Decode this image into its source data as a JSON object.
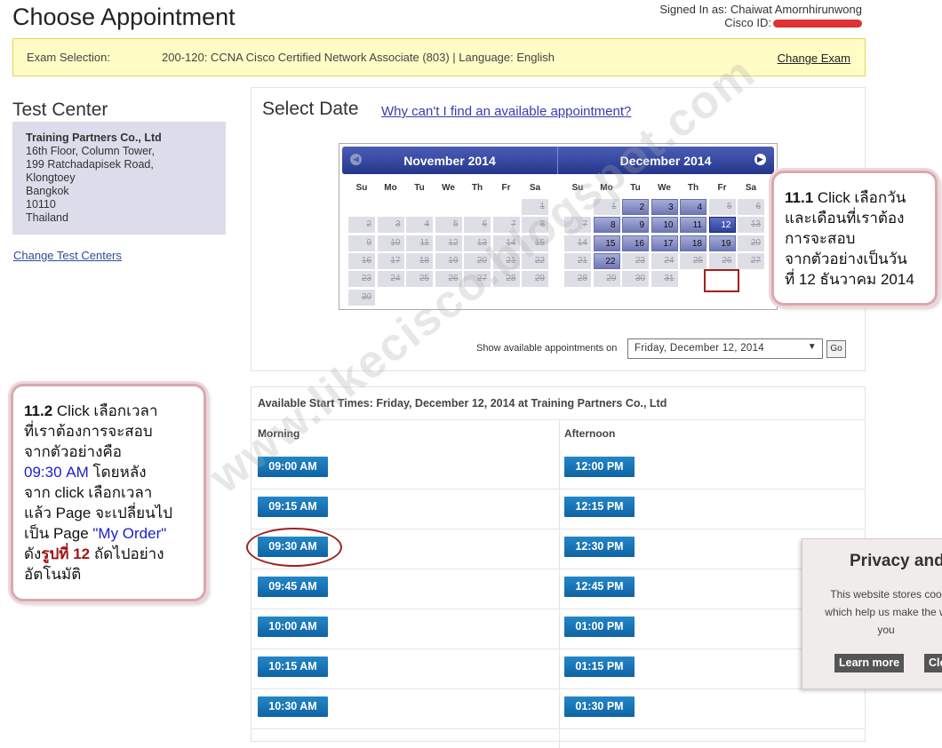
{
  "header": {
    "title": "Choose Appointment",
    "signed_in": "Signed In as: Chaiwat Amornhirunwong",
    "cisco_id_label": "Cisco ID:"
  },
  "exam": {
    "label": "Exam Selection:",
    "value": "200-120: CCNA Cisco Certified Network Associate (803) | Language: English",
    "change_label": "Change Exam"
  },
  "test_center": {
    "title": "Test Center",
    "name": "Training Partners Co., Ltd",
    "address_lines": [
      "16th Floor, Column Tower,",
      "199 Ratchadapisek Road,",
      "Klongtoey",
      "Bangkok",
      "10110",
      "Thailand"
    ],
    "change_label": "Change Test Centers"
  },
  "select_date": {
    "title": "Select Date",
    "help_link": "Why can't I find an available appointment?",
    "calendar": {
      "weekdays": [
        "Su",
        "Mo",
        "Tu",
        "We",
        "Th",
        "Fr",
        "Sa"
      ],
      "months": [
        {
          "name": "November 2014",
          "weeks": [
            [
              null,
              null,
              null,
              null,
              null,
              null,
              "1"
            ],
            [
              "2",
              "3",
              "4",
              "5",
              "6",
              "7",
              "8"
            ],
            [
              "9",
              "10",
              "11",
              "12",
              "13",
              "14",
              "15"
            ],
            [
              "16",
              "17",
              "18",
              "19",
              "20",
              "21",
              "22"
            ],
            [
              "23",
              "24",
              "25",
              "26",
              "27",
              "28",
              "29"
            ],
            [
              "30",
              null,
              null,
              null,
              null,
              null,
              null
            ]
          ],
          "available": [],
          "selected": null
        },
        {
          "name": "December 2014",
          "weeks": [
            [
              null,
              "1",
              "2",
              "3",
              "4",
              "5",
              "6"
            ],
            [
              "7",
              "8",
              "9",
              "10",
              "11",
              "12",
              "13"
            ],
            [
              "14",
              "15",
              "16",
              "17",
              "18",
              "19",
              "20"
            ],
            [
              "21",
              "22",
              "23",
              "24",
              "25",
              "26",
              "27"
            ],
            [
              "28",
              "29",
              "30",
              "31",
              null,
              null,
              null
            ]
          ],
          "available": [
            "2",
            "3",
            "4",
            "8",
            "9",
            "10",
            "11",
            "15",
            "16",
            "17",
            "18",
            "19",
            "22"
          ],
          "selected": "12"
        }
      ]
    },
    "show_label": "Show available appointments on",
    "show_value": "Friday, December 12, 2014",
    "go_label": "Go"
  },
  "times": {
    "heading": "Available Start Times: Friday, December 12, 2014 at Training Partners Co., Ltd",
    "morning_label": "Morning",
    "afternoon_label": "Afternoon",
    "morning": [
      "09:00 AM",
      "09:15 AM",
      "09:30 AM",
      "09:45 AM",
      "10:00 AM",
      "10:15 AM",
      "10:30 AM"
    ],
    "afternoon": [
      "12:00 PM",
      "12:15 PM",
      "12:30 PM",
      "12:45 PM",
      "01:00 PM",
      "01:15 PM",
      "01:30 PM"
    ]
  },
  "annotations": {
    "step1": {
      "num": "11.1",
      "text_a": " Click เลือกวัน",
      "lines": [
        "และเดือนที่เราต้อง",
        "การจะสอบ",
        "จากตัวอย่างเป็นวัน",
        "ที่ 12 ธันวาคม 2014"
      ]
    },
    "step2": {
      "num": "11.2",
      "text_a": " Click เลือกเวลา",
      "line2": "ที่เราต้องการจะสอบ",
      "line3": "จากตัวอย่างคือ",
      "time": "09:30 AM",
      "line4_tail": " โดยหลัง",
      "line5": "จาก click เลือกเวลา",
      "line6": "แล้ว Page จะเปลี่ยนไป",
      "line7_a": "เป็น Page ",
      "line7_b": "\"My Order\"",
      "line8_a": "ดัง",
      "line8_b": "รูปที่ 12",
      "line8_c": " ถัดไปอย่าง",
      "line9": "อัตโนมัติ"
    }
  },
  "privacy": {
    "title": "Privacy and",
    "line1": "This website stores coo",
    "line2": "which help us make the w",
    "line3": "you",
    "learn_more": "Learn more",
    "close": "Close"
  },
  "watermark": "www.likecisco.blogspot.com"
}
